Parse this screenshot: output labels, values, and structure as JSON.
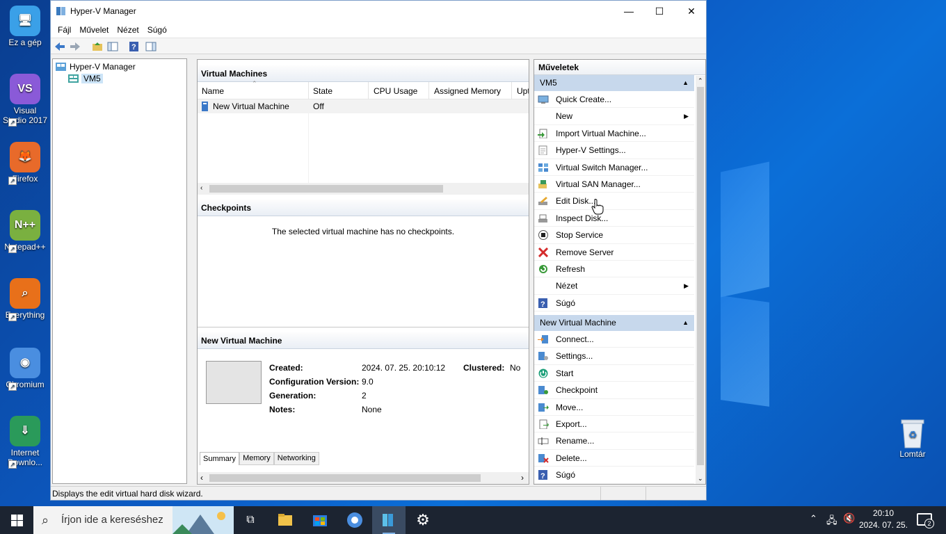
{
  "desktop": {
    "icons": [
      {
        "label": "Ez a gép",
        "glyph": "🖥"
      },
      {
        "label": "Visual Studio 2017",
        "glyph": "VS"
      },
      {
        "label": "Firefox",
        "glyph": "🦊"
      },
      {
        "label": "Notepad++",
        "glyph": "N++"
      },
      {
        "label": "Everything",
        "glyph": "⌕"
      },
      {
        "label": "Chromium",
        "glyph": "◉"
      },
      {
        "label": "Internet Downlo...",
        "glyph": "⇓"
      }
    ],
    "recycle_bin": "Lomtár"
  },
  "window": {
    "title": "Hyper-V Manager",
    "minimize": "—",
    "maximize": "☐",
    "close": "✕"
  },
  "menu": [
    "Fájl",
    "Művelet",
    "Nézet",
    "Súgó"
  ],
  "tree": {
    "root": "Hyper-V Manager",
    "child": "VM5"
  },
  "vms": {
    "header": "Virtual Machines",
    "columns": [
      "Name",
      "State",
      "CPU Usage",
      "Assigned Memory",
      "Upt"
    ],
    "rows": [
      {
        "name": "New Virtual Machine",
        "state": "Off"
      }
    ]
  },
  "checkpoints": {
    "header": "Checkpoints",
    "empty": "The selected virtual machine has no checkpoints."
  },
  "details": {
    "header": "New Virtual Machine",
    "created_label": "Created:",
    "created": "2024. 07. 25. 20:10:12",
    "clustered_label": "Clustered:",
    "clustered": "No",
    "config_label": "Configuration Version:",
    "config": "9.0",
    "gen_label": "Generation:",
    "gen": "2",
    "notes_label": "Notes:",
    "notes": "None",
    "tabs": [
      "Summary",
      "Memory",
      "Networking"
    ]
  },
  "actions": {
    "header": "Műveletek",
    "section1": "VM5",
    "items1": [
      {
        "label": "Quick Create...",
        "icon": "monitor-icon"
      },
      {
        "label": "New",
        "icon": "none",
        "submenu": true
      },
      {
        "label": "Import Virtual Machine...",
        "icon": "import-icon"
      },
      {
        "label": "Hyper-V Settings...",
        "icon": "settings-page-icon"
      },
      {
        "label": "Virtual Switch Manager...",
        "icon": "switch-icon"
      },
      {
        "label": "Virtual SAN Manager...",
        "icon": "san-icon"
      },
      {
        "label": "Edit Disk...",
        "icon": "edit-disk-icon"
      },
      {
        "label": "Inspect Disk...",
        "icon": "inspect-disk-icon"
      },
      {
        "label": "Stop Service",
        "icon": "stop-icon"
      },
      {
        "label": "Remove Server",
        "icon": "remove-icon"
      },
      {
        "label": "Refresh",
        "icon": "refresh-icon"
      },
      {
        "label": "Nézet",
        "icon": "none",
        "submenu": true
      },
      {
        "label": "Súgó",
        "icon": "help-icon"
      }
    ],
    "section2": "New Virtual Machine",
    "items2": [
      {
        "label": "Connect...",
        "icon": "connect-icon"
      },
      {
        "label": "Settings...",
        "icon": "vm-settings-icon"
      },
      {
        "label": "Start",
        "icon": "power-icon"
      },
      {
        "label": "Checkpoint",
        "icon": "checkpoint-icon"
      },
      {
        "label": "Move...",
        "icon": "move-icon"
      },
      {
        "label": "Export...",
        "icon": "export-icon"
      },
      {
        "label": "Rename...",
        "icon": "rename-icon"
      },
      {
        "label": "Delete...",
        "icon": "delete-icon"
      },
      {
        "label": "Súgó",
        "icon": "help-icon"
      }
    ]
  },
  "status": "Displays the edit virtual hard disk wizard.",
  "taskbar": {
    "search_placeholder": "Írjon ide a kereséshez",
    "time": "20:10",
    "date": "2024. 07. 25.",
    "notif_count": "2"
  }
}
